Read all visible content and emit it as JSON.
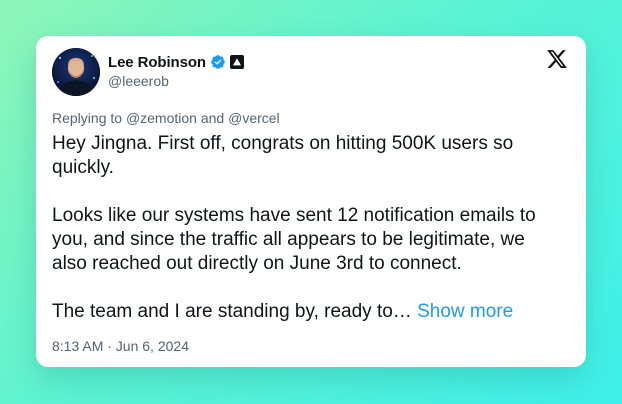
{
  "tweet": {
    "author_name": "Lee Robinson",
    "author_handle": "@leeerob",
    "reply_prefix": "Replying to",
    "reply_mention_1": "@zemotion",
    "reply_and": "and",
    "reply_mention_2": "@vercel",
    "paragraph_1": "Hey Jingna. First off, congrats on hitting 500K users so quickly.",
    "paragraph_2": "Looks like our systems have sent 12 notification emails to you, and since the traffic all appears to be legitimate, we also reached out directly on June 3rd to connect.",
    "paragraph_3": "The team and I are standing by, ready to…",
    "show_more": "Show more",
    "timestamp": "8:13 AM · Jun 6, 2024"
  },
  "icons": {
    "verified": "verified-badge-icon",
    "org": "triangle-org-badge-icon",
    "platform": "x-logo-icon"
  },
  "colors": {
    "link": "#1d9bf0",
    "verified": "#1d9bf0",
    "text": "#0f1419",
    "muted": "#536471"
  }
}
